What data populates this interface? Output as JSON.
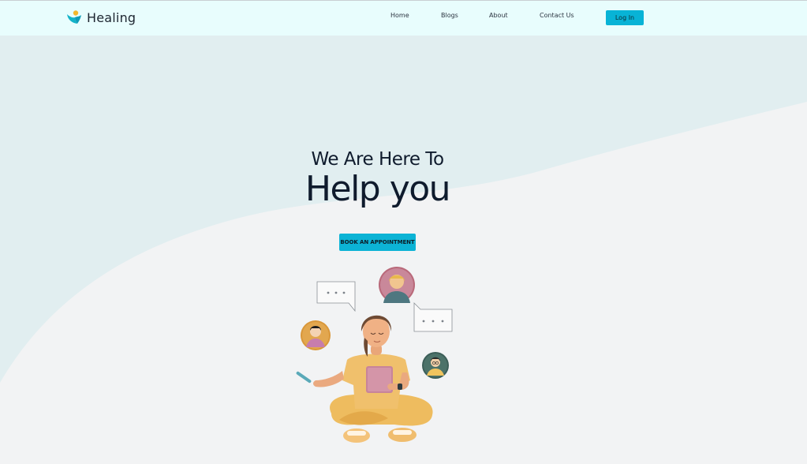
{
  "brand": {
    "name": "Healing",
    "icon": "healing-logo-icon"
  },
  "nav": {
    "home": "Home",
    "blogs": "Blogs",
    "about": "About",
    "contact": "Contact Us",
    "login": "Log In"
  },
  "hero": {
    "subtitle": "We Are Here To",
    "title": "Help you",
    "cta": "BOOK AN APPOINTMENT"
  },
  "illustration": {
    "icon": "meditating-person-with-tablet-illustration",
    "bubbles": [
      "chat-bubble-icon",
      "chat-bubble-icon"
    ],
    "avatars": [
      "avatar-woman-icon",
      "avatar-person-icon",
      "avatar-man-glasses-icon"
    ]
  },
  "colors": {
    "header_bg": "#e8fdfd",
    "accent": "#0cb3d5",
    "hero_wave": "#e1eef0",
    "page_bg": "#f2f3f4",
    "text": "#0f1b2d"
  }
}
